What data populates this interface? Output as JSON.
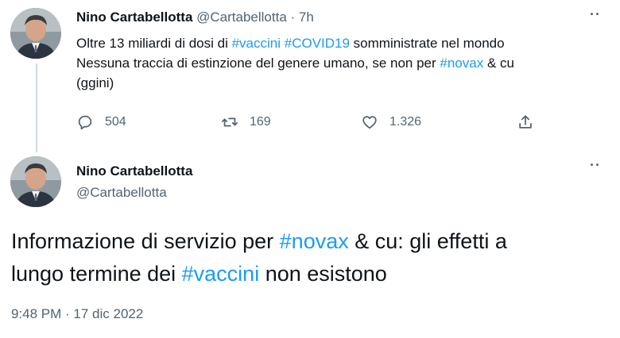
{
  "tweet1": {
    "author_name": "Nino Cartabellotta",
    "handle": "@Cartabellotta",
    "separator": " · ",
    "time": "7h",
    "more_label": "··",
    "text": {
      "l1_a": "Oltre 13 miliardi di dosi di ",
      "l1_h1": "#vaccini",
      "l1_sp": " ",
      "l1_h2": "#COVID19",
      "l1_b": " somministrate nel mondo",
      "l2_a": "Nessuna traccia di estinzione del genere umano, se non per ",
      "l2_h": "#novax",
      "l2_b": " & cu",
      "l3": "(ggini)"
    },
    "actions": {
      "reply_count": "504",
      "retweet_count": "169",
      "like_count": "1.326"
    },
    "icons": [
      "reply-icon",
      "retweet-icon",
      "like-icon",
      "share-icon"
    ]
  },
  "tweet2": {
    "author_name": "Nino Cartabellotta",
    "handle": "@Cartabellotta",
    "more_label": "··",
    "text": {
      "a": "Informazione di servizio per ",
      "h1": "#novax",
      "b": " & cu: gli effetti a",
      "c": "lungo termine dei ",
      "h2": "#vaccini",
      "d": " non esistono"
    },
    "timestamp": "9:48 PM · 17 dic 2022"
  },
  "colors": {
    "hashtag": "#1d9bf0",
    "secondary_text": "#536471",
    "primary_text": "#0f1419",
    "thread_line": "#cfd9de"
  }
}
